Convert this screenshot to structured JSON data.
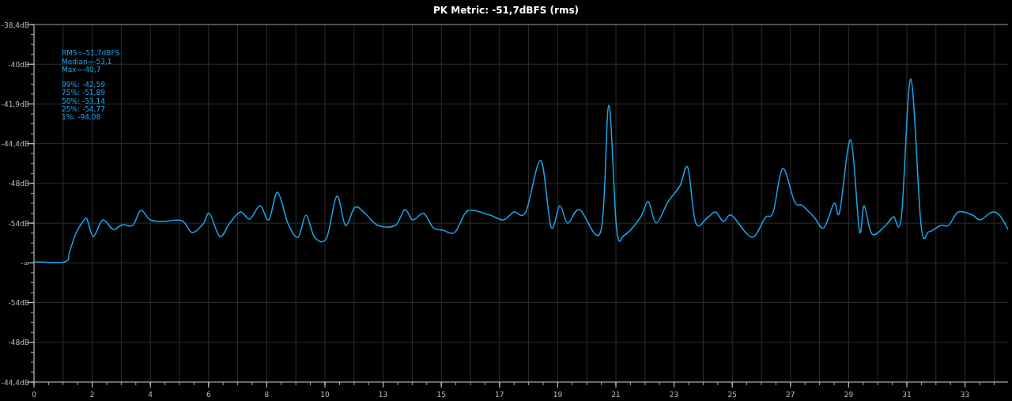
{
  "title": "PK Metric: -51,7dBFS (rms)",
  "summary": [
    "RMS=-51,7dBFS",
    "Median=-53,1",
    "Max=-40,7"
  ],
  "percentiles": [
    "99%: -42,59",
    "75%: -51,89",
    "50%: -53,14",
    "25%: -54,77",
    "1%: -94,08"
  ],
  "y_labels": [
    "-38,4dB",
    "-40dB",
    "-41,9dB",
    "-44,4dB",
    "-48dB",
    "-54dB",
    "-∞",
    "-54dB",
    "-48dB",
    "-44,4dB"
  ],
  "x_labels": [
    "0",
    "2",
    "4",
    "6",
    "8",
    "10",
    "13",
    "15",
    "17",
    "19",
    "21",
    "23",
    "25",
    "27",
    "29",
    "31",
    "33"
  ]
}
